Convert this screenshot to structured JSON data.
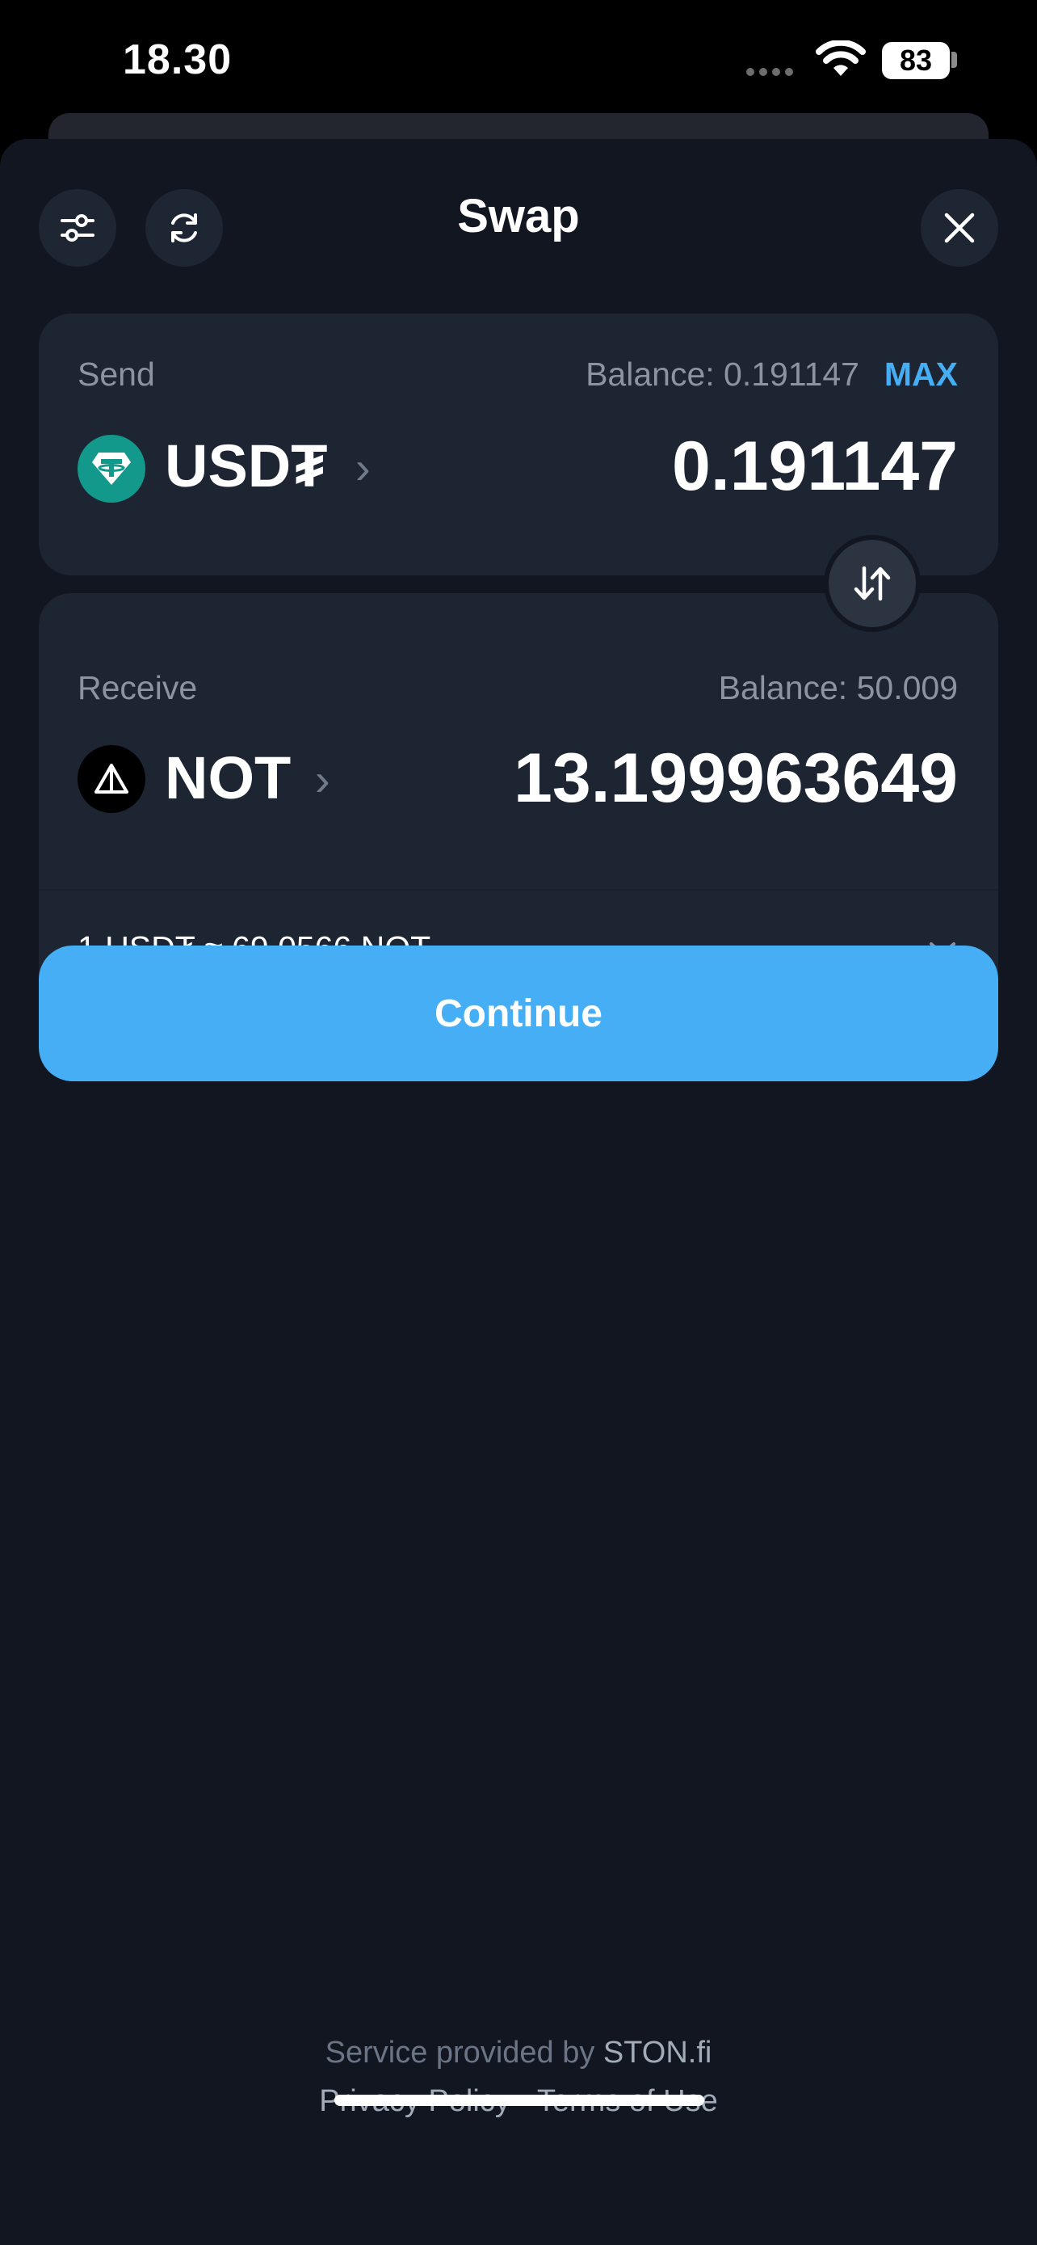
{
  "status_bar": {
    "time": "18.30",
    "battery": "83"
  },
  "header": {
    "title": "Swap",
    "settings_icon": "sliders-icon",
    "refresh_icon": "refresh-icon",
    "close_icon": "close-icon"
  },
  "send": {
    "label": "Send",
    "balance": "Balance: 0.191147",
    "max_label": "MAX",
    "token": "USD₮",
    "amount": "0.191147",
    "token_color": "#13998b"
  },
  "receive": {
    "label": "Receive",
    "balance": "Balance: 50.009",
    "token": "NOT",
    "amount": "13.199963649",
    "token_color": "#000000"
  },
  "rate": {
    "text": "1 USD₮ ≈ 69.0566 NOT"
  },
  "actions": {
    "continue": "Continue"
  },
  "footer": {
    "service_prefix": "Service provided by",
    "provider": "STON.fi",
    "privacy": "Privacy Policy",
    "separator": "·",
    "terms": "Terms of Use"
  },
  "colors": {
    "accent": "#45aef5",
    "background": "#111620",
    "card": "#1d2532"
  }
}
